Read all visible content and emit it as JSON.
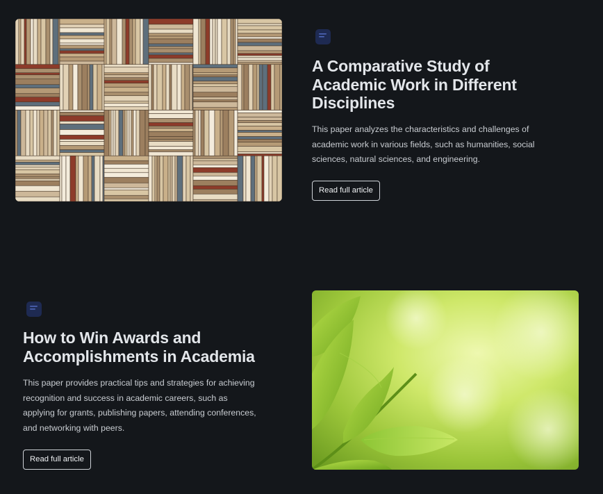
{
  "articles": [
    {
      "image_icon": "bookshelf-photo",
      "badge_icon": "document-icon",
      "title": "A Comparative Study of Academic Work in Different Disciplines",
      "description": "This paper analyzes the characteristics and challenges of academic work in various fields, such as humanities, social sciences, natural sciences, and engineering.",
      "button_label": "Read full article"
    },
    {
      "image_icon": "green-leaves-photo",
      "badge_icon": "document-icon",
      "title": "How to Win Awards and Accomplishments in Academia",
      "description": "This paper provides practical tips and strategies for achieving recognition and success in academic careers, such as applying for grants, publishing papers, attending conferences, and networking with peers.",
      "button_label": "Read full article"
    }
  ],
  "colors": {
    "background": "#14171b",
    "title": "#e3e6ea",
    "text": "#c9cdd2",
    "badge": "#1e2a52"
  }
}
